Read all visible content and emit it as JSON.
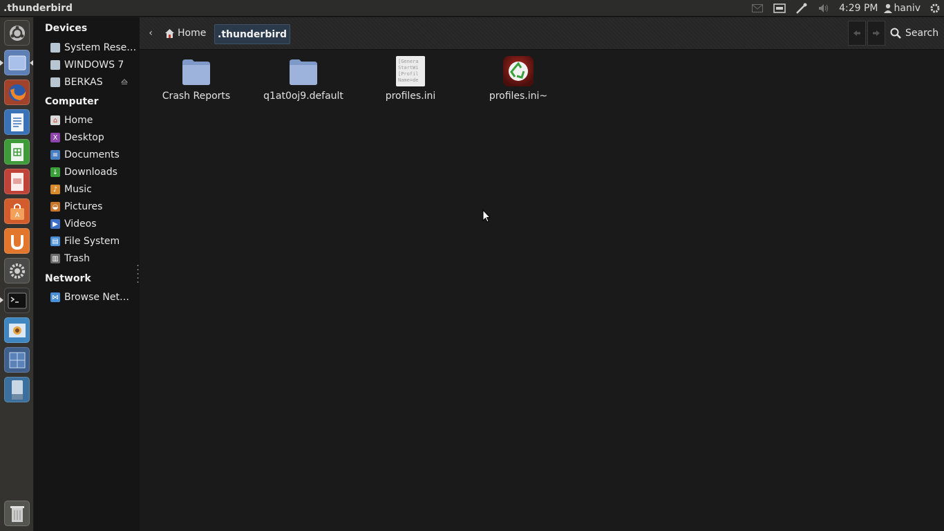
{
  "window": {
    "title": ".thunderbird"
  },
  "panel": {
    "indicators": [
      "mail-icon",
      "keyboard-icon",
      "network-icon",
      "volume-icon"
    ],
    "clock": "4:29 PM",
    "user": "haniv"
  },
  "launcher": {
    "items": [
      "ubuntu-dash",
      "files",
      "firefox",
      "libreoffice-writer",
      "libreoffice-calc",
      "libreoffice-impress",
      "software-center",
      "ubuntu-one",
      "system-settings",
      "terminal",
      "screenshot",
      "workspace-switcher",
      "removable-drive",
      "trash"
    ]
  },
  "sidebar": {
    "devices_header": "Devices",
    "devices": [
      "System Rese…",
      "WINDOWS 7",
      "BERKAS"
    ],
    "computer_header": "Computer",
    "computer": [
      "Home",
      "Desktop",
      "Documents",
      "Downloads",
      "Music",
      "Pictures",
      "Videos",
      "File System",
      "Trash"
    ],
    "network_header": "Network",
    "network": [
      "Browse Net…"
    ]
  },
  "toolbar": {
    "crumb_home": "Home",
    "crumb_current": ".thunderbird",
    "search": "Search"
  },
  "files": [
    {
      "name": "Crash Reports",
      "kind": "folder"
    },
    {
      "name": "q1at0oj9.default",
      "kind": "folder"
    },
    {
      "name": "profiles.ini",
      "kind": "text",
      "preview": [
        "[Genera",
        "StartWi",
        "[Profil",
        "Name=de"
      ]
    },
    {
      "name": "profiles.ini~",
      "kind": "backup"
    }
  ],
  "colors": {
    "accent": "#2b3a4a",
    "folder": "#8fa8d6",
    "background": "#1a1a1a"
  }
}
